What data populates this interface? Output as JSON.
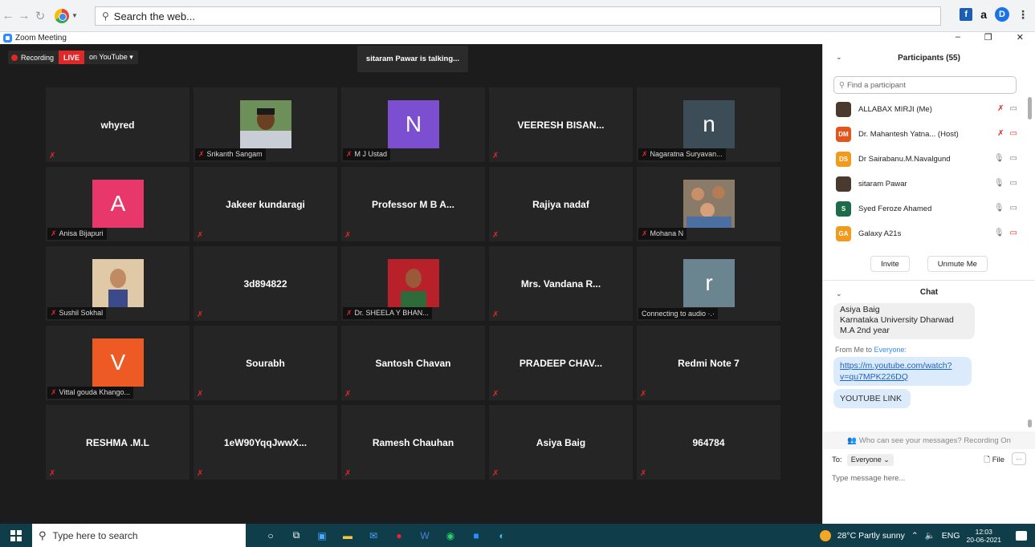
{
  "browser": {
    "search_placeholder": "Search the web...",
    "ext_f": "f",
    "ext_a": "a",
    "ext_d": "D",
    "menu": "⋮"
  },
  "window": {
    "title": "Zoom Meeting",
    "minimize": "–",
    "restore": "❐",
    "close": "✕"
  },
  "meeting": {
    "recording_label": "Recording",
    "live_label": "LIVE",
    "youtube_label": "on YouTube ▾",
    "talking": "sitaram Pawar is talking..."
  },
  "tiles": [
    {
      "type": "name",
      "name": "whyred",
      "label": ""
    },
    {
      "type": "photo",
      "label": "Srikanth Sangam",
      "photo": "man1"
    },
    {
      "type": "letter",
      "letter": "N",
      "color": "#7b4fd0",
      "label": "M J Ustad"
    },
    {
      "type": "name",
      "name": "VEERESH  BISAN...",
      "label": ""
    },
    {
      "type": "letter",
      "letter": "n",
      "color": "#3d4d57",
      "label": "Nagaratna Suryavan..."
    },
    {
      "type": "letter",
      "letter": "A",
      "color": "#e8386b",
      "label": "Anisa Bijapuri"
    },
    {
      "type": "name",
      "name": "Jakeer kundaragi",
      "label": ""
    },
    {
      "type": "name",
      "name": "Professor M B A...",
      "label": ""
    },
    {
      "type": "name",
      "name": "Rajiya nadaf",
      "label": ""
    },
    {
      "type": "photo",
      "label": "Mohana N",
      "photo": "group"
    },
    {
      "type": "photo",
      "label": "Sushil Sokhal",
      "photo": "child"
    },
    {
      "type": "name",
      "name": "3d894822",
      "label": ""
    },
    {
      "type": "photo",
      "label": "Dr. SHEELA Y BHAN...",
      "photo": "woman"
    },
    {
      "type": "name",
      "name": "Mrs. Vandana R...",
      "label": ""
    },
    {
      "type": "letter",
      "letter": "r",
      "color": "#6b8590",
      "label": "Connecting to audio ·.·",
      "nomic": true
    },
    {
      "type": "letter",
      "letter": "V",
      "color": "#ee5a24",
      "label": "Vittal gouda Khango..."
    },
    {
      "type": "name",
      "name": "Sourabh",
      "label": ""
    },
    {
      "type": "name",
      "name": "Santosh Chavan",
      "label": ""
    },
    {
      "type": "name",
      "name": "PRADEEP  CHAV...",
      "label": ""
    },
    {
      "type": "name",
      "name": "Redmi Note 7",
      "label": ""
    },
    {
      "type": "name",
      "name": "RESHMA .M.L",
      "label": ""
    },
    {
      "type": "name",
      "name": "1eW90YqqJwwX...",
      "label": ""
    },
    {
      "type": "name",
      "name": "Ramesh Chauhan",
      "label": ""
    },
    {
      "type": "name",
      "name": "Asiya Baig",
      "label": ""
    },
    {
      "type": "name",
      "name": "964784",
      "label": ""
    }
  ],
  "participants": {
    "title": "Participants (55)",
    "search_placeholder": "Find a participant",
    "list": [
      {
        "name": "ALLABAX MIRJI (Me)",
        "initials": "",
        "color": "#555",
        "photo": true
      },
      {
        "name": "Dr. Mahantesh Yatna... (Host)",
        "initials": "DM",
        "color": "#e2561e"
      },
      {
        "name": "Dr Sairabanu.M.Navalgund",
        "initials": "DS",
        "color": "#f29a1b"
      },
      {
        "name": "sitaram Pawar",
        "initials": "",
        "color": "#555",
        "photo": true
      },
      {
        "name": "Syed Feroze Ahamed",
        "initials": "S",
        "color": "#1e6b4a"
      },
      {
        "name": "Galaxy A21s",
        "initials": "GA",
        "color": "#f29a1b"
      }
    ],
    "invite": "Invite",
    "unmute": "Unmute Me"
  },
  "chat": {
    "title": "Chat",
    "msg1_line1": "Asiya Baig",
    "msg1_line2": "Karnataka University Dharwad",
    "msg1_line3": "M.A 2nd year",
    "from_prefix": "From Me to ",
    "from_target": "Everyone",
    "from_suffix": ":",
    "link": "https://m.youtube.com/watch?v=qu7MPK226DQ",
    "youtube_link": "YOUTUBE LINK",
    "visibility": "Who can see your messages? Recording On",
    "to_label": "To:",
    "to_value": "Everyone ⌄",
    "file": "File",
    "more": "···",
    "placeholder": "Type message here..."
  },
  "taskbar": {
    "search": "Type here to search",
    "weather": "28°C  Partly sunny",
    "lang": "ENG",
    "time": "12:03",
    "date": "20-06-2021"
  }
}
